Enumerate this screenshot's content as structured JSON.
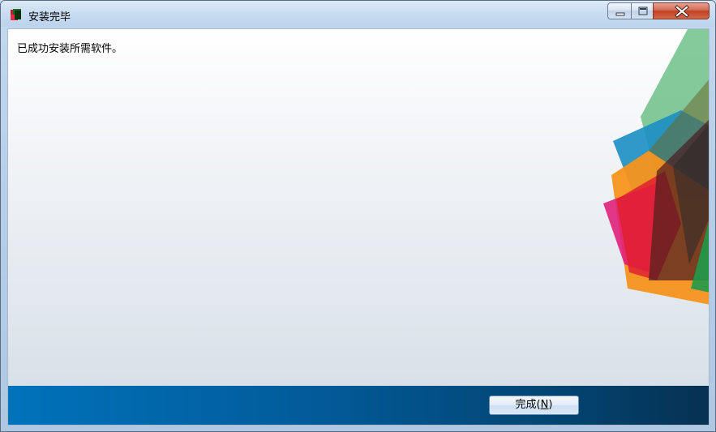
{
  "window": {
    "title": "安装完毕",
    "controls": {
      "minimize": "minimize-icon",
      "maximize": "maximize-icon",
      "close": "close-icon"
    }
  },
  "main": {
    "message": "已成功安装所需软件。"
  },
  "footer": {
    "finish_label_prefix": "完成(",
    "finish_label_mnemonic": "N",
    "finish_label_suffix": ")"
  },
  "colors": {
    "footer_start": "#0072bb",
    "footer_end": "#073152",
    "art_green": "#5cb878",
    "art_blue": "#1b8fc3",
    "art_orange": "#f7941d",
    "art_red": "#e02030",
    "art_magenta": "#e0207a",
    "art_dark": "#3a2a2a"
  }
}
